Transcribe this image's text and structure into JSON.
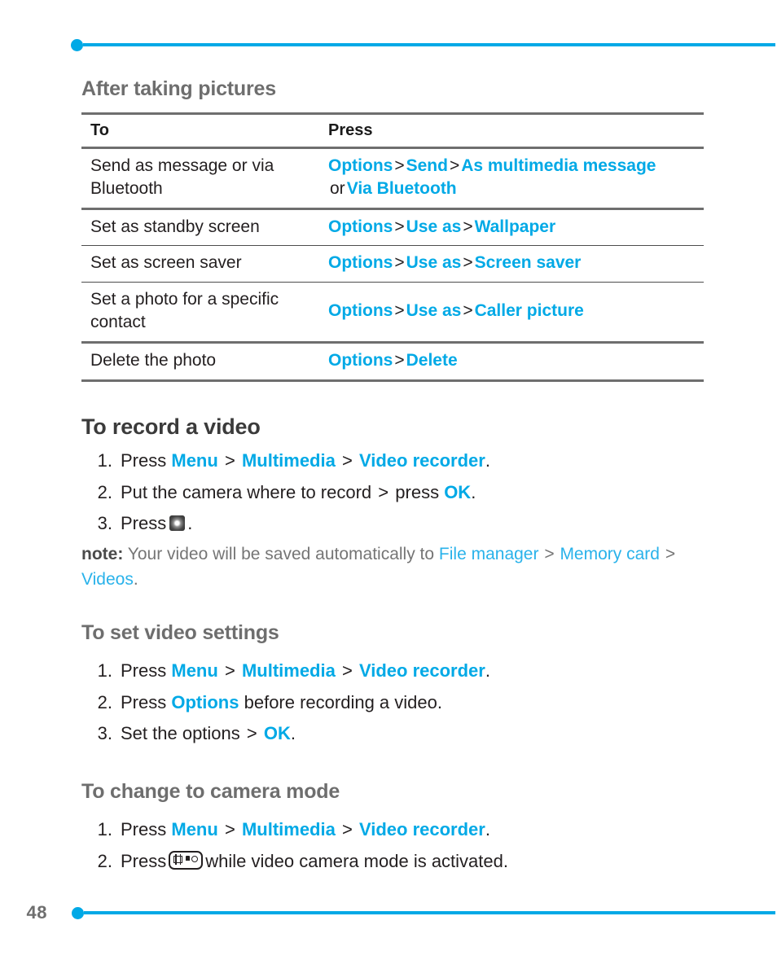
{
  "page": {
    "number": "48"
  },
  "table_section": {
    "heading": "After taking pictures",
    "columns": [
      "To",
      "Press"
    ],
    "rows": [
      {
        "to": "Send as message or via Bluetooth",
        "press_parts": [
          "Options",
          ">",
          "Send",
          ">",
          "As multimedia message",
          "or",
          "Via Bluetooth"
        ],
        "press_p1": "Options",
        "press_s1": ">",
        "press_p2": "Send",
        "press_s2": ">",
        "press_p3": "As multimedia message",
        "press_or": "or",
        "press_p4": "Via Bluetooth"
      },
      {
        "to": "Set as standby screen",
        "press_p1": "Options",
        "press_s1": ">",
        "press_p2": "Use as",
        "press_s2": ">",
        "press_p3": "Wallpaper"
      },
      {
        "to": "Set as screen saver",
        "press_p1": "Options",
        "press_s1": ">",
        "press_p2": "Use as",
        "press_s2": ">",
        "press_p3": "Screen saver"
      },
      {
        "to": "Set a photo for a specific contact",
        "press_p1": "Options",
        "press_s1": ">",
        "press_p2": "Use as",
        "press_s2": ">",
        "press_p3": "Caller picture"
      },
      {
        "to": "Delete the photo",
        "press_p1": "Options",
        "press_s1": ">",
        "press_p2": "Delete"
      }
    ]
  },
  "record_video": {
    "heading": "To record a video",
    "step1": {
      "num": "1.",
      "t1": "Press",
      "b1": "Menu",
      "s1": ">",
      "b2": "Multimedia",
      "s2": ">",
      "b3": "Video recorder",
      "t2": "."
    },
    "step2": {
      "num": "2.",
      "t1": "Put the camera where to record",
      "s1": ">",
      "t2": "press",
      "b1": "OK",
      "t3": "."
    },
    "step3": {
      "num": "3.",
      "t1": "Press",
      "icon": "record-key-icon",
      "t2": "."
    },
    "note": {
      "label": "note:",
      "t1": "Your video will be saved automatically to",
      "b1": "File manager",
      "s1": ">",
      "b2": "Memory card",
      "s2": ">",
      "b3": "Videos",
      "t2": "."
    }
  },
  "video_settings": {
    "heading": "To set video settings",
    "step1": {
      "num": "1.",
      "t1": "Press",
      "b1": "Menu",
      "s1": ">",
      "b2": "Multimedia",
      "s2": ">",
      "b3": "Video recorder",
      "t2": "."
    },
    "step2": {
      "num": "2.",
      "t1": "Press",
      "b1": "Options",
      "t2": "before recording a video."
    },
    "step3": {
      "num": "3.",
      "t1": "Set the options",
      "s1": ">",
      "b1": "OK",
      "t2": "."
    }
  },
  "camera_mode": {
    "heading": "To change to camera mode",
    "step1": {
      "num": "1.",
      "t1": "Press",
      "b1": "Menu",
      "s1": ">",
      "b2": "Multimedia",
      "s2": ">",
      "b3": "Video recorder",
      "t2": "."
    },
    "step2": {
      "num": "2.",
      "t1": "Press",
      "icon": "camera-key-icon",
      "t2": "while video camera mode is activated."
    }
  },
  "colors": {
    "accent_blue": "#00a9e6",
    "note_blue": "#29b2ea",
    "heading_gray": "#6e6e6e",
    "rule_gray": "#6e6e6e",
    "body_black": "#231f20"
  }
}
